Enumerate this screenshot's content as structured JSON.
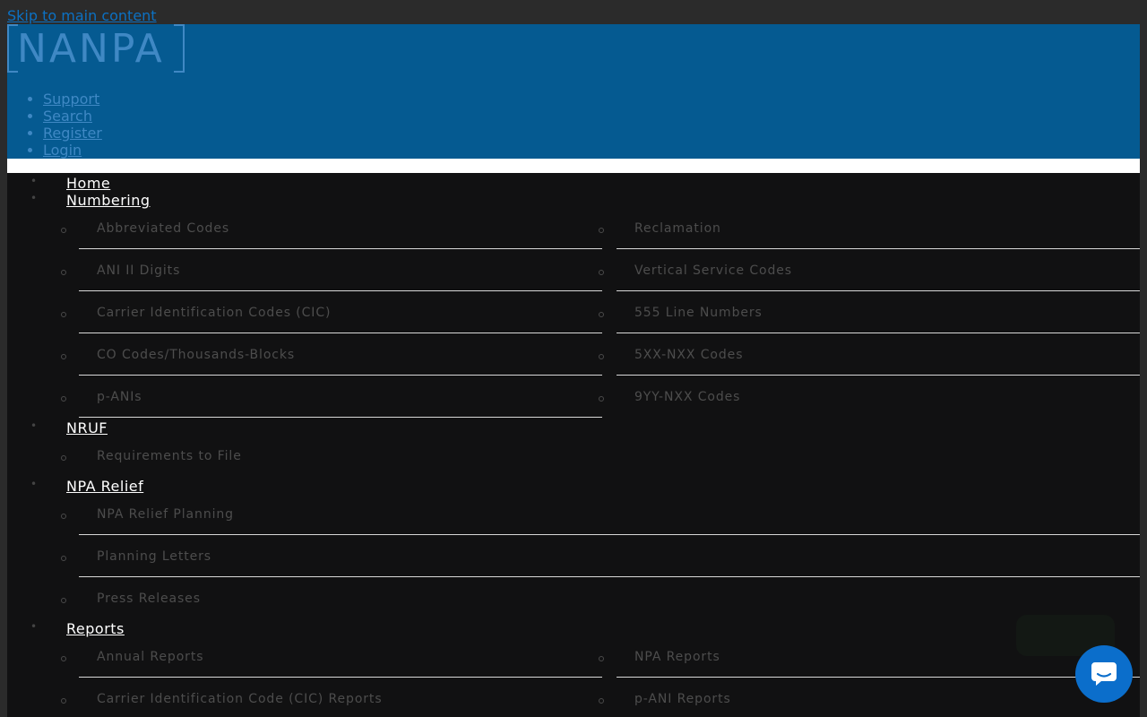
{
  "skip_link": "Skip to main content",
  "logo": {
    "text": "NANPA"
  },
  "utility_nav": [
    {
      "label": "Support"
    },
    {
      "label": "Search",
      "icon": "search-icon",
      "glyph": ""
    },
    {
      "label": "Register"
    },
    {
      "label": "Login"
    }
  ],
  "main_nav": {
    "home": "Home",
    "numbering": {
      "label": "Numbering",
      "left": [
        "Abbreviated Codes",
        "ANI II Digits",
        "Carrier Identification Codes (CIC)",
        "CO Codes/Thousands-Blocks",
        "p-ANIs"
      ],
      "right": [
        "Reclamation",
        "Vertical Service Codes",
        "555 Line Numbers",
        "5XX-NXX Codes",
        "9YY-NXX Codes"
      ]
    },
    "nruf": {
      "label": "NRUF",
      "items": [
        "Requirements to File"
      ]
    },
    "npa_relief": {
      "label": "NPA Relief",
      "items": [
        "NPA Relief Planning",
        "Planning Letters",
        "Press Releases"
      ]
    },
    "reports": {
      "label": "Reports",
      "left": [
        "Annual Reports",
        "Carrier Identification Code (CIC) Reports"
      ],
      "right": [
        "NPA Reports",
        "p-ANI Reports"
      ]
    }
  },
  "chat": {
    "icon": "chat-icon",
    "color": "#0b6ecb"
  },
  "colors": {
    "header": "#055a91",
    "nav": "#111112",
    "link": "#0c71c3"
  }
}
